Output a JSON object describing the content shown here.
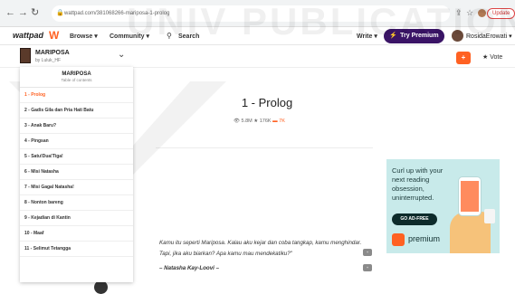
{
  "browser": {
    "url": "wattpad.com/381068266-mariposa-1-prolog",
    "update_label": "Update",
    "back_icon": "arrow-left",
    "forward_icon": "arrow-right",
    "reload_icon": "reload"
  },
  "header": {
    "logo": "wattpad",
    "logo_mark": "W",
    "browse_label": "Browse ▾",
    "community_label": "Community ▾",
    "search_label": "Search",
    "write_label": "Write ▾",
    "premium_label": "Try Premium",
    "username": "RosidaErowati ▾"
  },
  "story": {
    "title": "MARIPOSA",
    "author": "by Luluk_HF",
    "vote_label": "Vote",
    "add_label": "+"
  },
  "toc": {
    "title": "MARIPOSA",
    "subtitle": "Table of contents",
    "items": [
      "1 - Prolog",
      "2 - Gadis Gila dan Pria Hati Batu",
      "3 - Anak Baru?",
      "4 - Pingsan",
      "5 - Satu!Dua!Tiga!",
      "6 - Misi Natasha",
      "7 - Misi Gagal Natasha!",
      "8 - Nonton bareng",
      "9 - Kejadian di Kantin",
      "10 - Maaf",
      "11 - Selimut Tetangga"
    ]
  },
  "chapter": {
    "title": "1 - Prolog",
    "reads": "5.8M",
    "votes": "176K",
    "comments": "7K",
    "paragraph": "Kamu itu seperti Mariposa. Kalau aku kejar dan coba tangkap, kamu menghindar. Tapi, jika aku biarkan? Apa kamu mau mendekatiku?\"",
    "quote_author": "– Natasha Kay-Loovi –",
    "comment_icon_1": "+",
    "comment_icon_2": "+"
  },
  "ad": {
    "text": "Curl up with your next reading obsession, uninterrupted.",
    "button": "GO AD-FREE",
    "brand": "premium"
  },
  "watermark": "UNIV PUBLICATIONS",
  "colors": {
    "accent": "#ff6122",
    "premium": "#3a1466",
    "twitter": "#1da1f2",
    "pinterest": "#e60023"
  }
}
